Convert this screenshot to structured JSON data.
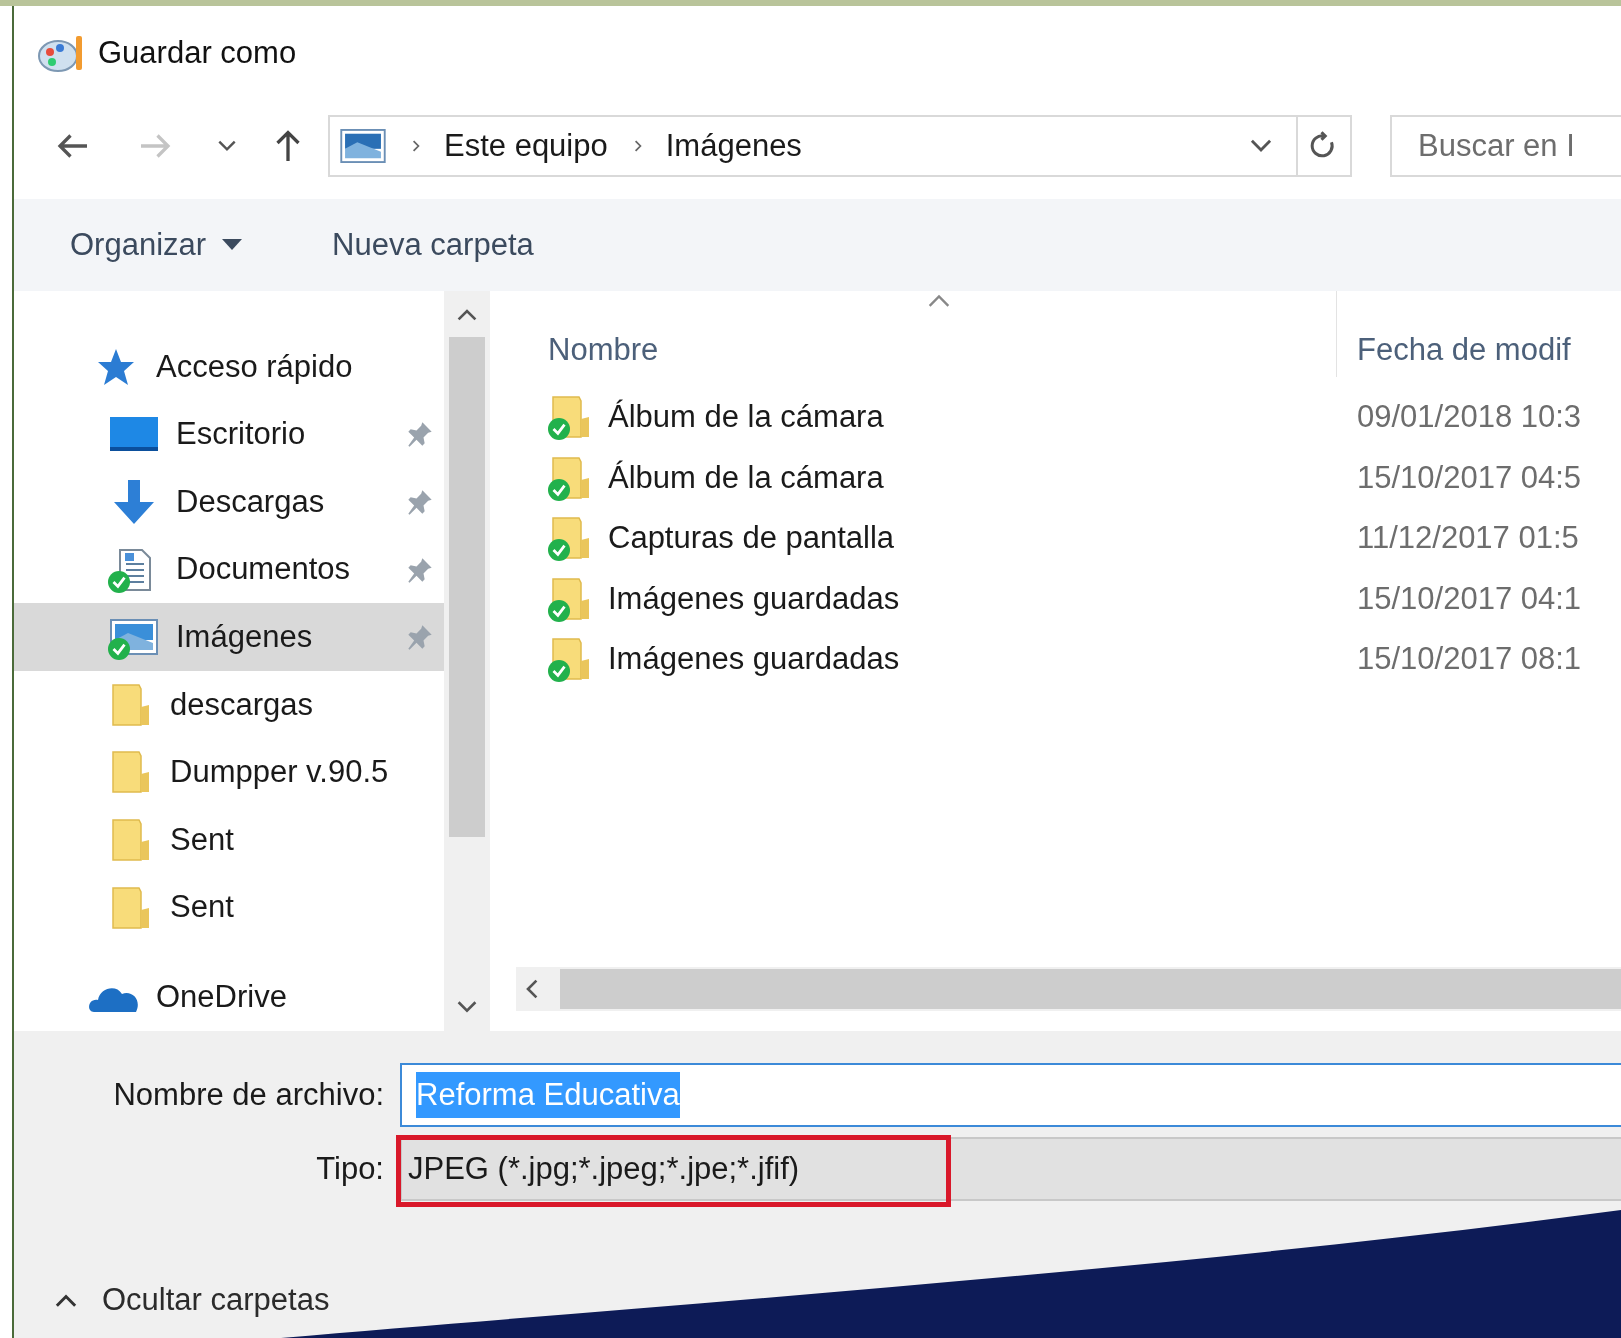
{
  "window": {
    "title": "Guardar como"
  },
  "address_bar": {
    "path": [
      "Este equipo",
      "Imágenes"
    ]
  },
  "search": {
    "placeholder": "Buscar en I"
  },
  "toolbar": {
    "organize": "Organizar",
    "new_folder": "Nueva carpeta"
  },
  "sidebar": {
    "items": [
      {
        "label": "Acceso rápido",
        "kind": "star",
        "selected": false,
        "children": [
          {
            "label": "Escritorio",
            "kind": "desktop",
            "selected": false,
            "pinned": true,
            "synced": false
          },
          {
            "label": "Descargas",
            "kind": "download",
            "selected": false,
            "pinned": true,
            "synced": false
          },
          {
            "label": "Documentos",
            "kind": "documents",
            "selected": false,
            "pinned": true,
            "synced": true
          },
          {
            "label": "Imágenes",
            "kind": "pictures",
            "selected": true,
            "pinned": true,
            "synced": true
          },
          {
            "label": "descargas",
            "kind": "folder",
            "selected": false,
            "pinned": false,
            "synced": false
          },
          {
            "label": "Dumpper v.90.5",
            "kind": "folder",
            "selected": false,
            "pinned": false,
            "synced": false
          },
          {
            "label": "Sent",
            "kind": "folder",
            "selected": false,
            "pinned": false,
            "synced": false
          },
          {
            "label": "Sent",
            "kind": "folder",
            "selected": false,
            "pinned": false,
            "synced": false
          }
        ]
      },
      {
        "label": "OneDrive",
        "kind": "cloud",
        "selected": false
      }
    ]
  },
  "table": {
    "columns": [
      "Nombre",
      "Fecha de modif"
    ],
    "rows": [
      {
        "name": "Álbum de la cámara",
        "date": "09/01/2018 10:3",
        "synced": true
      },
      {
        "name": "Álbum de la cámara",
        "date": "15/10/2017 04:5",
        "synced": true
      },
      {
        "name": "Capturas de pantalla",
        "date": "11/12/2017 01:5",
        "synced": true
      },
      {
        "name": "Imágenes guardadas",
        "date": "15/10/2017 04:1",
        "synced": true
      },
      {
        "name": "Imágenes guardadas",
        "date": "15/10/2017 08:1",
        "synced": true
      }
    ]
  },
  "file_name": {
    "label": "Nombre de archivo:",
    "value": "Reforma Educativa",
    "selected": true
  },
  "file_type": {
    "label": "Tipo:",
    "value": "JPEG (*.jpg;*.jpeg;*.jpe;*.jfif)",
    "highlighted": true
  },
  "hide_folders": "Ocultar carpetas"
}
